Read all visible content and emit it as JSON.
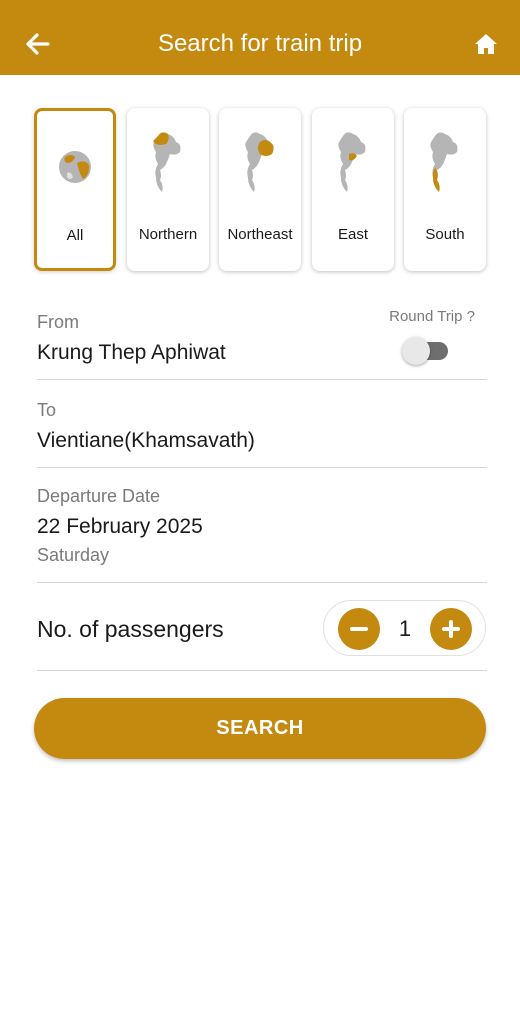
{
  "header": {
    "title": "Search for train trip",
    "back_icon": "arrow-left-icon",
    "home_icon": "home-icon",
    "color": "#c4890f"
  },
  "regions": [
    {
      "label": "All",
      "selected": true,
      "icon": "globe-icon"
    },
    {
      "label": "Northern",
      "selected": false,
      "icon": "thailand-map-north-icon"
    },
    {
      "label": "Northeast",
      "selected": false,
      "icon": "thailand-map-northeast-icon"
    },
    {
      "label": "East",
      "selected": false,
      "icon": "thailand-map-east-icon"
    },
    {
      "label": "South",
      "selected": false,
      "icon": "thailand-map-south-icon"
    }
  ],
  "from": {
    "label": "From",
    "value": "Krung Thep Aphiwat"
  },
  "round_trip": {
    "label": "Round Trip ?",
    "enabled": false
  },
  "to": {
    "label": "To",
    "value": "Vientiane(Khamsavath)"
  },
  "departure": {
    "label": "Departure Date",
    "date": "22 February 2025",
    "weekday": "Saturday"
  },
  "passengers": {
    "label": "No. of passengers",
    "count": "1"
  },
  "search_button": {
    "label": "SEARCH"
  }
}
